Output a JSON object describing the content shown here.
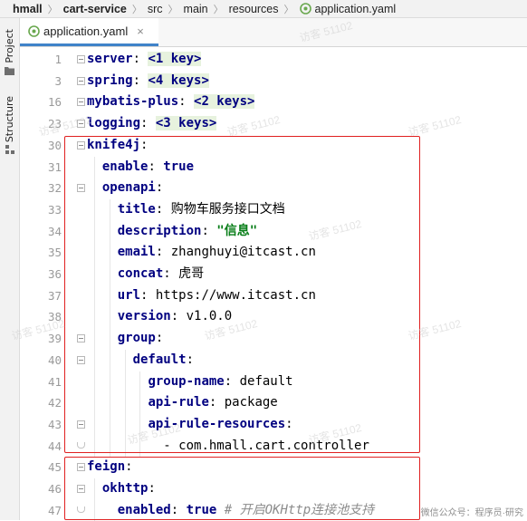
{
  "breadcrumb": {
    "items": [
      "hmall",
      "cart-service",
      "src",
      "main",
      "resources",
      "application.yaml"
    ]
  },
  "sidebar": {
    "project_label": "Project",
    "structure_label": "Structure"
  },
  "tab": {
    "title": "application.yaml"
  },
  "editor": {
    "lines": [
      {
        "n": "1",
        "key": "server",
        "rest": ": ",
        "folded": "<1 key>"
      },
      {
        "n": "3",
        "key": "spring",
        "rest": ": ",
        "folded": "<4 keys>"
      },
      {
        "n": "16",
        "key": "mybatis-plus",
        "rest": ": ",
        "folded": "<2 keys>"
      },
      {
        "n": "23",
        "key": "logging",
        "rest": ": ",
        "folded": "<3 keys>"
      },
      {
        "n": "30",
        "key": "knife4j",
        "rest": ":"
      },
      {
        "n": "31",
        "key": "enable",
        "rest": ": ",
        "value": "true",
        "vtype": "bool"
      },
      {
        "n": "32",
        "key": "openapi",
        "rest": ":"
      },
      {
        "n": "33",
        "key": "title",
        "rest": ": ",
        "value": "购物车服务接口文档"
      },
      {
        "n": "34",
        "key": "description",
        "rest": ": ",
        "value": "\"信息\"",
        "vtype": "str"
      },
      {
        "n": "35",
        "key": "email",
        "rest": ": ",
        "value": "zhanghuyi@itcast.cn"
      },
      {
        "n": "36",
        "key": "concat",
        "rest": ": ",
        "value": "虎哥"
      },
      {
        "n": "37",
        "key": "url",
        "rest": ": ",
        "value": "https://www.itcast.cn"
      },
      {
        "n": "38",
        "key": "version",
        "rest": ": ",
        "value": "v1.0.0"
      },
      {
        "n": "39",
        "key": "group",
        "rest": ":"
      },
      {
        "n": "40",
        "key": "default",
        "rest": ":"
      },
      {
        "n": "41",
        "key": "group-name",
        "rest": ": ",
        "value": "default"
      },
      {
        "n": "42",
        "key": "api-rule",
        "rest": ": ",
        "value": "package"
      },
      {
        "n": "43",
        "key": "api-rule-resources",
        "rest": ":"
      },
      {
        "n": "44",
        "dash": "- ",
        "value": "com.hmall.cart.controller"
      },
      {
        "n": "45",
        "key": "feign",
        "rest": ":"
      },
      {
        "n": "46",
        "key": "okhttp",
        "rest": ":"
      },
      {
        "n": "47",
        "key": "enabled",
        "rest": ": ",
        "value": "true",
        "vtype": "bool",
        "comment": " # 开启OKHttp连接池支持"
      }
    ]
  },
  "watermark": {
    "text": "访客 51102",
    "corner": "微信公众号：程序员·研究"
  },
  "colors": {
    "key": "#000080",
    "string": "#067d17",
    "comment": "#8c8c8c",
    "highlight_box": "#e02020",
    "folded_bg": "#e7f2de",
    "tab_underline": "#4083c9"
  }
}
